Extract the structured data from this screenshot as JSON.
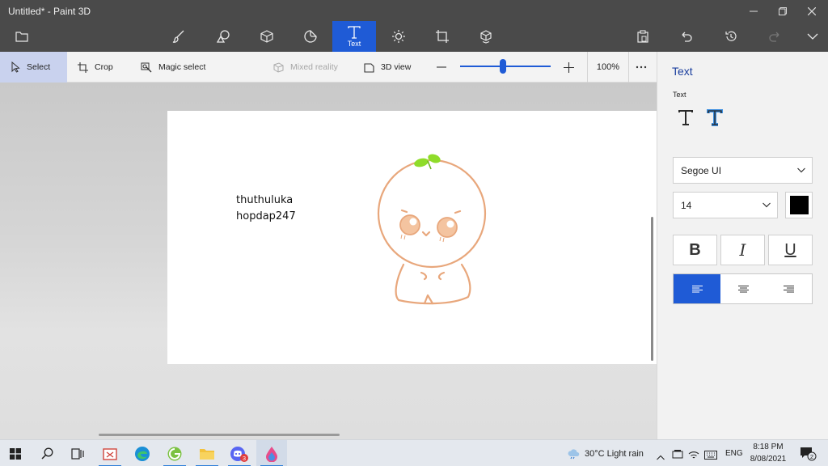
{
  "window": {
    "title": "Untitled* - Paint 3D",
    "controls": [
      "minimize-icon",
      "maximize-icon",
      "close-icon"
    ]
  },
  "toolbar": {
    "tools": [
      {
        "id": "brushes",
        "icon": "brush-icon"
      },
      {
        "id": "2d-shapes",
        "icon": "2d-shapes-icon"
      },
      {
        "id": "3d-shapes",
        "icon": "3d-cube-icon"
      },
      {
        "id": "stickers",
        "icon": "sticker-icon"
      },
      {
        "id": "text",
        "icon": "text-icon",
        "label": "Text",
        "active": true
      },
      {
        "id": "effects",
        "icon": "effects-icon"
      },
      {
        "id": "canvas",
        "icon": "canvas-crop-icon"
      },
      {
        "id": "3d-library",
        "icon": "3d-library-icon"
      }
    ],
    "right_icons": [
      "paste-icon",
      "undo-icon",
      "history-icon",
      "redo-icon",
      "expand-chevron-icon"
    ],
    "menu_icon": "folder-icon"
  },
  "subtoolbar": {
    "select_label": "Select",
    "crop_label": "Crop",
    "magic_select_label": "Magic select",
    "mixed_reality_label": "Mixed reality",
    "view3d_label": "3D view",
    "zoom_value": "100%",
    "zoom_level_fraction": 0.47,
    "more_icon": "more-ellipsis-icon"
  },
  "canvas": {
    "text_lines": [
      "thuthuluka",
      "hopdap247"
    ],
    "drawing": "sad-orange-character-with-green-sprout"
  },
  "panel": {
    "title": "Text",
    "subtitle": "Text",
    "text_type_icons": [
      "2d-text-icon",
      "3d-text-icon"
    ],
    "font_family": "Segoe UI",
    "font_size": "14",
    "color": "#000000",
    "bold_label": "B",
    "italic_label": "I",
    "underline_label": "U",
    "alignment": "left"
  },
  "taskbar": {
    "icons": [
      "windows-start-icon",
      "search-icon",
      "task-view-icon",
      "snipping-tool-icon",
      "edge-icon",
      "greenshot-icon",
      "file-explorer-icon",
      "discord-icon",
      "paint-3d-icon"
    ],
    "discord_badge": "3",
    "weather": "30°C  Light rain",
    "language": "ENG",
    "time": "8:18 PM",
    "date": "8/08/2021",
    "notification_count": "2"
  },
  "colors": {
    "accent": "#1f5bd6",
    "titlebar": "#4a4a4a",
    "drawing_line": "#e8a77c",
    "sprout": "#8fdc2a"
  }
}
